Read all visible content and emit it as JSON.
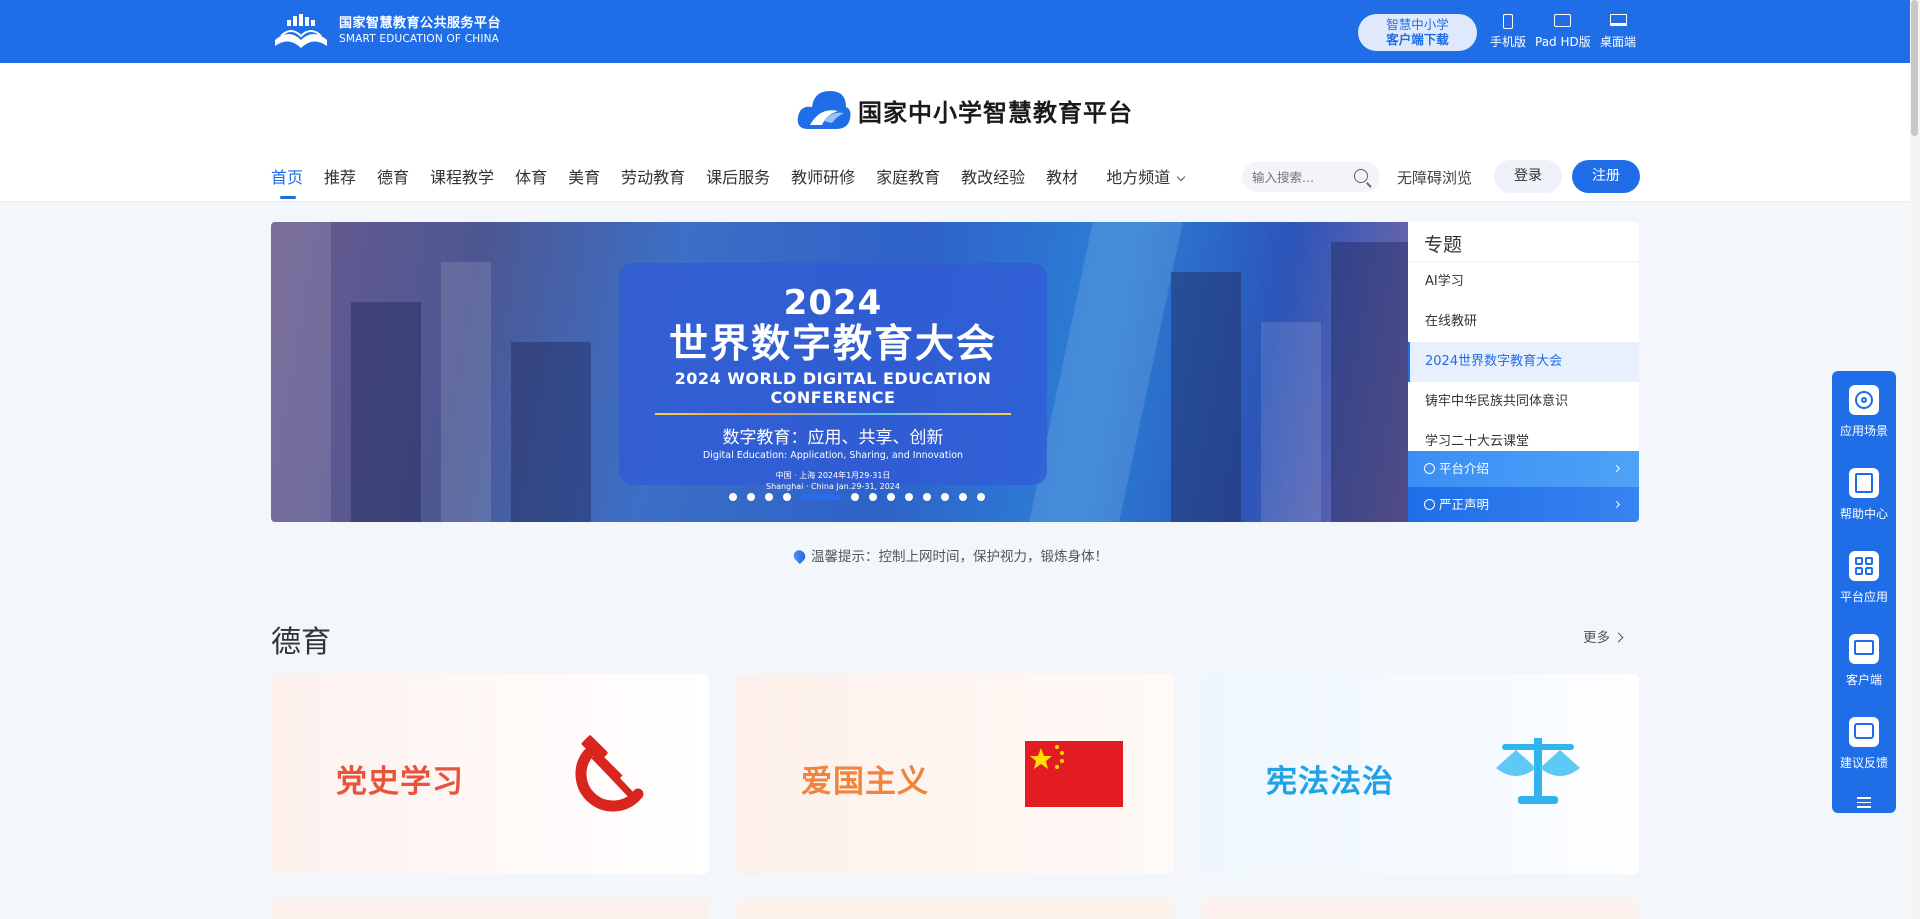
{
  "topbar": {
    "logo_cn": "国家智慧教育公共服务平台",
    "logo_en": "SMART EDUCATION OF CHINA",
    "app_download_line1": "智慧中小学",
    "app_download_line2": "客户端下载",
    "devices": [
      {
        "label": "手机版",
        "icon": "phone-icon"
      },
      {
        "label": "Pad HD版",
        "icon": "tablet-icon"
      },
      {
        "label": "桌面端",
        "icon": "laptop-icon"
      }
    ]
  },
  "header": {
    "brand_title": "国家中小学智慧教育平台",
    "nav": [
      "首页",
      "推荐",
      "德育",
      "课程教学",
      "体育",
      "美育",
      "劳动教育",
      "课后服务",
      "教师研修",
      "家庭教育",
      "教改经验",
      "教材",
      "地方频道"
    ],
    "active_nav": "首页",
    "search_placeholder": "输入搜索...",
    "accessible": "无障碍浏览",
    "login": "登录",
    "register": "注册"
  },
  "banner": {
    "year": "2024",
    "title": "世界数字教育大会",
    "title_en": "2024 WORLD DIGITAL EDUCATION CONFERENCE",
    "subtitle": "数字教育：应用、共享、创新",
    "subtitle_en": "Digital Education: Application, Sharing, and Innovation",
    "place_cn": "中国 · 上海 2024年1月29-31日",
    "place_en": "Shanghai · China Jan.29-31, 2024",
    "slide_count": 13,
    "active_slide": 5
  },
  "topics": {
    "title": "专题",
    "items": [
      "AI学习",
      "在线教研",
      "2024世界数字教育大会",
      "铸牢中华民族共同体意识",
      "学习二十大云课堂"
    ],
    "active_item": "2024世界数字教育大会",
    "links": [
      "平台介绍",
      "严正声明"
    ]
  },
  "tip": "温馨提示：控制上网时间，保护视力，锻炼身体！",
  "section": {
    "title": "德育",
    "more": "更多",
    "cards": [
      {
        "label": "党史学习",
        "icon": "hammer-sickle-icon"
      },
      {
        "label": "爱国主义",
        "icon": "china-flag-icon"
      },
      {
        "label": "宪法法治",
        "icon": "scales-icon"
      }
    ]
  },
  "floatbar": {
    "items": [
      {
        "label": "应用场景",
        "icon": "scene-icon"
      },
      {
        "label": "帮助中心",
        "icon": "help-icon"
      },
      {
        "label": "平台应用",
        "icon": "apps-grid-icon"
      },
      {
        "label": "客户端",
        "icon": "client-icon"
      },
      {
        "label": "建议反馈",
        "icon": "feedback-icon"
      }
    ]
  },
  "colors": {
    "primary": "#1f6ee8",
    "page_bg": "#f3f6fb"
  }
}
